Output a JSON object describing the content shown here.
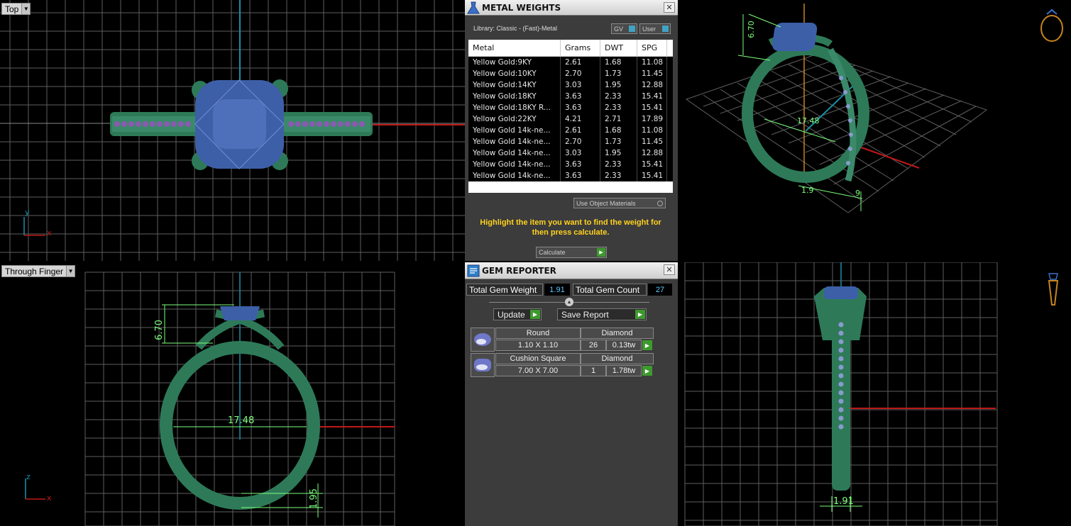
{
  "viewports": {
    "top": {
      "label": "Top",
      "axis_x": "x",
      "axis_y": "y"
    },
    "front": {
      "label": "Through Finger",
      "axis_x": "x",
      "axis_z": "z",
      "dim_height": "6.70",
      "dim_width": "17.48",
      "dim_band": "1.95"
    },
    "perspective": {
      "dim_height": "6.70",
      "dim_width": "17.48",
      "dim_band_a": "1.9",
      "dim_band_b": "9"
    },
    "side": {
      "dim_band": "1.91"
    }
  },
  "metal_weights": {
    "title": "METAL WEIGHTS",
    "close": "✕",
    "library": "Library: Classic - (Fast)-Metal",
    "toggle_gv": "GV",
    "toggle_user": "User",
    "columns": [
      "Metal",
      "Grams",
      "DWT",
      "SPG"
    ],
    "rows": [
      [
        "Yellow Gold:9KY",
        "2.61",
        "1.68",
        "11.08"
      ],
      [
        "Yellow Gold:10KY",
        "2.70",
        "1.73",
        "11.45"
      ],
      [
        "Yellow Gold:14KY",
        "3.03",
        "1.95",
        "12.88"
      ],
      [
        "Yellow Gold:18KY",
        "3.63",
        "2.33",
        "15.41"
      ],
      [
        "Yellow Gold:18KY R...",
        "3.63",
        "2.33",
        "15.41"
      ],
      [
        "Yellow Gold:22KY",
        "4.21",
        "2.71",
        "17.89"
      ],
      [
        "Yellow Gold 14k-ne...",
        "2.61",
        "1.68",
        "11.08"
      ],
      [
        "Yellow Gold 14k-ne...",
        "2.70",
        "1.73",
        "11.45"
      ],
      [
        "Yellow Gold 14k-ne...",
        "3.03",
        "1.95",
        "12.88"
      ],
      [
        "Yellow Gold 14k-ne...",
        "3.63",
        "2.33",
        "15.41"
      ],
      [
        "Yellow Gold 14k-ne...",
        "3.63",
        "2.33",
        "15.41"
      ]
    ],
    "use_object_materials": "Use Object Materials",
    "hint": "Highlight the item you want to find the weight for then press calculate.",
    "calculate": "Calculate"
  },
  "gem_reporter": {
    "title": "GEM REPORTER",
    "close": "✕",
    "total_weight_label": "Total Gem Weight",
    "total_weight": "1.91",
    "total_count_label": "Total Gem Count",
    "total_count": "27",
    "update": "Update",
    "save_report": "Save Report",
    "gems": [
      {
        "shape": "Round",
        "size": "1.10 X 1.10",
        "type": "Diamond",
        "count": "26",
        "weight": "0.13tw"
      },
      {
        "shape": "Cushion Square",
        "size": "7.00 X 7.00",
        "type": "Diamond",
        "count": "1",
        "weight": "1.78tw"
      }
    ]
  },
  "colors": {
    "ring": "#2e7a58",
    "stone": "#3d5fa8",
    "grid": "#5e5e5e",
    "axis_red": "#c01818",
    "axis_blue": "#1a8fa8",
    "dim": "#7cff7c",
    "hint": "#ffd21e"
  }
}
